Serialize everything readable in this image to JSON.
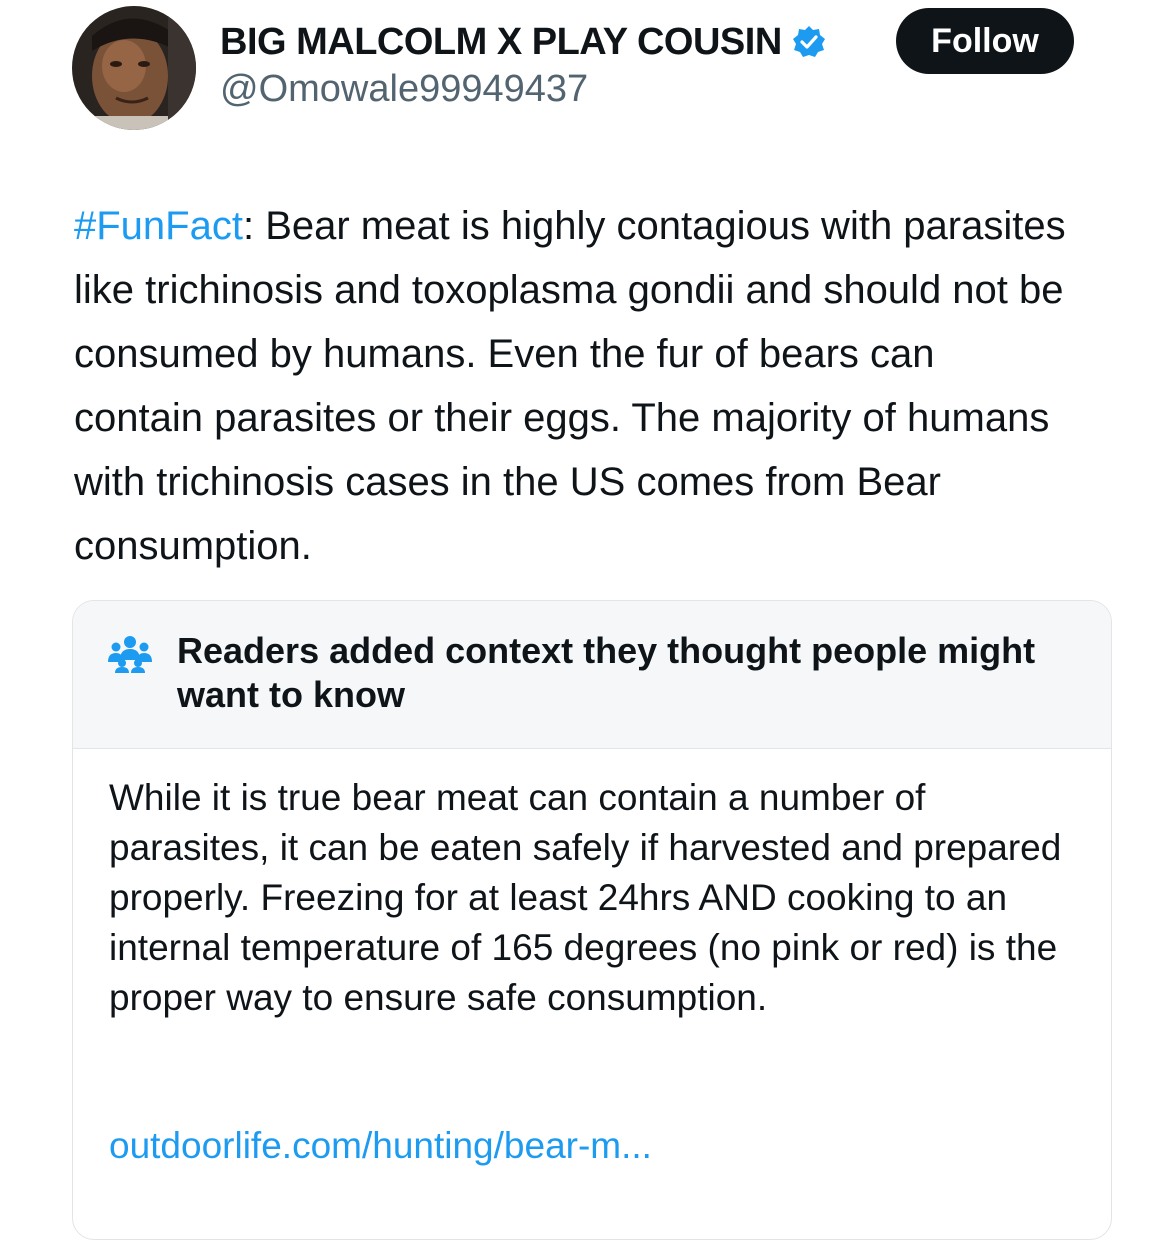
{
  "author": {
    "display_name": "BIG MALCOLM X PLAY COUSIN",
    "handle": "@Omowale99949437",
    "verified_icon": "verified-badge-icon",
    "avatar": "profile-photo"
  },
  "follow_button": {
    "label": "Follow"
  },
  "tweet": {
    "hashtag": "#FunFact",
    "text": ": Bear meat is highly contagious with parasites like trichinosis and toxoplasma gondii and should not be consumed by humans. Even the fur of bears can contain parasites or their eggs. The majority of humans with trichinosis cases in the US comes from Bear consumption."
  },
  "community_note": {
    "icon": "people-icon",
    "title": "Readers added context they thought people might want to know",
    "body": "While it is true bear meat can contain a number of parasites, it can be eaten safely if harvested and prepared properly. Freezing for at least 24hrs AND cooking to an internal temperature of 165 degrees (no pink or red) is the proper way to ensure safe consumption.",
    "link_text": "outdoorlife.com/hunting/bear-m..."
  },
  "colors": {
    "accent": "#1d9bf0",
    "text_primary": "#0f1419",
    "text_secondary": "#536471",
    "note_header_bg": "#f5f7f8",
    "border": "#e1e5e8",
    "button_bg": "#0f1419"
  }
}
